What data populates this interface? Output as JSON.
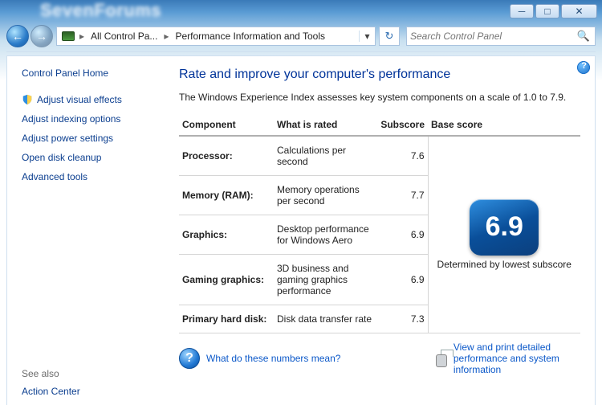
{
  "window": {
    "ghost_title": "SevenForums",
    "min_glyph": "─",
    "max_glyph": "□",
    "close_glyph": "✕"
  },
  "nav": {
    "back_glyph": "←",
    "fwd_glyph": "→",
    "refresh_glyph": "↻",
    "search_placeholder": "Search Control Panel",
    "search_glyph": "🔍",
    "dropdown_glyph": "▾",
    "sep_glyph": "▸",
    "crumb1": "All Control Pa...",
    "crumb2": "Performance Information and Tools"
  },
  "sidebar": {
    "home": "Control Panel Home",
    "links": [
      "Adjust visual effects",
      "Adjust indexing options",
      "Adjust power settings",
      "Open disk cleanup",
      "Advanced tools"
    ],
    "see_also": "See also",
    "action_center": "Action Center"
  },
  "main": {
    "title": "Rate and improve your computer's performance",
    "intro": "The Windows Experience Index assesses key system components on a scale of 1.0 to 7.9.",
    "headers": {
      "component": "Component",
      "what": "What is rated",
      "subscore": "Subscore",
      "base": "Base score"
    },
    "rows": [
      {
        "component": "Processor:",
        "desc": "Calculations per second",
        "subscore": "7.6"
      },
      {
        "component": "Memory (RAM):",
        "desc": "Memory operations per second",
        "subscore": "7.7"
      },
      {
        "component": "Graphics:",
        "desc": "Desktop performance for Windows Aero",
        "subscore": "6.9"
      },
      {
        "component": "Gaming graphics:",
        "desc": "3D business and gaming graphics performance",
        "subscore": "6.9"
      },
      {
        "component": "Primary hard disk:",
        "desc": "Disk data transfer rate",
        "subscore": "7.3"
      }
    ],
    "base_score": "6.9",
    "base_caption": "Determined by lowest subscore",
    "footer": {
      "q": "?",
      "what_link": "What do these numbers mean?",
      "print_link": "View and print detailed performance and system information"
    }
  }
}
